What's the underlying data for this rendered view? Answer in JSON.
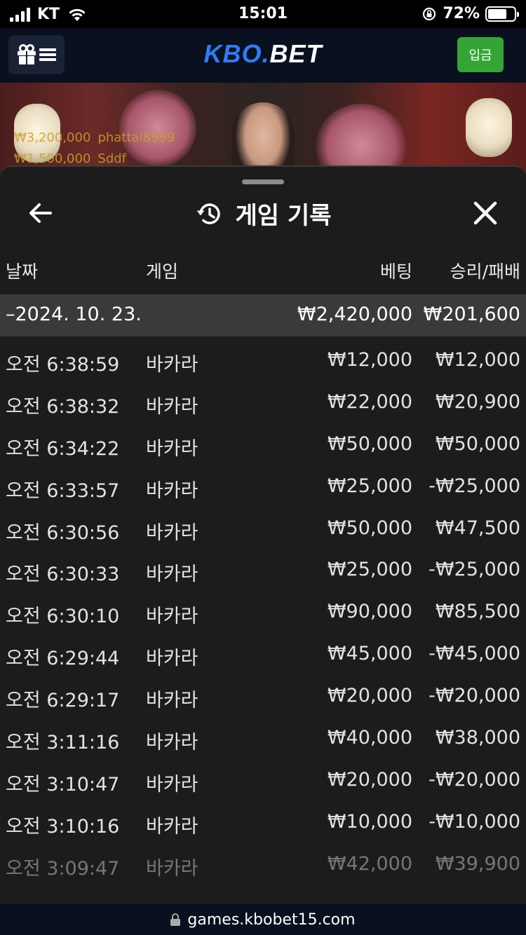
{
  "status_bar": {
    "carrier": "KT",
    "time": "15:01",
    "battery": "72%",
    "battery_level": 0.72
  },
  "header": {
    "logo_part1": "KBO.",
    "logo_part2": "BET",
    "deposit_label": "입금",
    "brand_blue": "#2e7cf6",
    "deposit_green": "#34a534"
  },
  "video": {
    "ticker": [
      {
        "amount": "₩3,200,000",
        "user": "phattai8999"
      },
      {
        "amount": "₩1,500,000",
        "user": "Sddf"
      }
    ]
  },
  "sheet": {
    "title": "게임 기록",
    "columns": {
      "date": "날짜",
      "game": "게임",
      "bet": "베팅",
      "result": "승리/패배"
    },
    "summary": {
      "date": "–2024. 10. 23.",
      "bet": "₩2,420,000",
      "result": "₩201,600"
    },
    "rows": [
      {
        "time": "오전 6:38:59",
        "game": "바카라",
        "bet": "₩12,000",
        "result": "₩12,000"
      },
      {
        "time": "오전 6:38:32",
        "game": "바카라",
        "bet": "₩22,000",
        "result": "₩20,900"
      },
      {
        "time": "오전 6:34:22",
        "game": "바카라",
        "bet": "₩50,000",
        "result": "₩50,000"
      },
      {
        "time": "오전 6:33:57",
        "game": "바카라",
        "bet": "₩25,000",
        "result": "-₩25,000"
      },
      {
        "time": "오전 6:30:56",
        "game": "바카라",
        "bet": "₩50,000",
        "result": "₩47,500"
      },
      {
        "time": "오전 6:30:33",
        "game": "바카라",
        "bet": "₩25,000",
        "result": "-₩25,000"
      },
      {
        "time": "오전 6:30:10",
        "game": "바카라",
        "bet": "₩90,000",
        "result": "₩85,500"
      },
      {
        "time": "오전 6:29:44",
        "game": "바카라",
        "bet": "₩45,000",
        "result": "-₩45,000"
      },
      {
        "time": "오전 6:29:17",
        "game": "바카라",
        "bet": "₩20,000",
        "result": "-₩20,000"
      },
      {
        "time": "오전 3:11:16",
        "game": "바카라",
        "bet": "₩40,000",
        "result": "₩38,000"
      },
      {
        "time": "오전 3:10:47",
        "game": "바카라",
        "bet": "₩20,000",
        "result": "-₩20,000"
      },
      {
        "time": "오전 3:10:16",
        "game": "바카라",
        "bet": "₩10,000",
        "result": "-₩10,000"
      },
      {
        "time": "오전 3:09:47",
        "game": "바카라",
        "bet": "₩42,000",
        "result": "₩39,900"
      }
    ]
  },
  "browser": {
    "url": "games.kbobet15.com"
  }
}
